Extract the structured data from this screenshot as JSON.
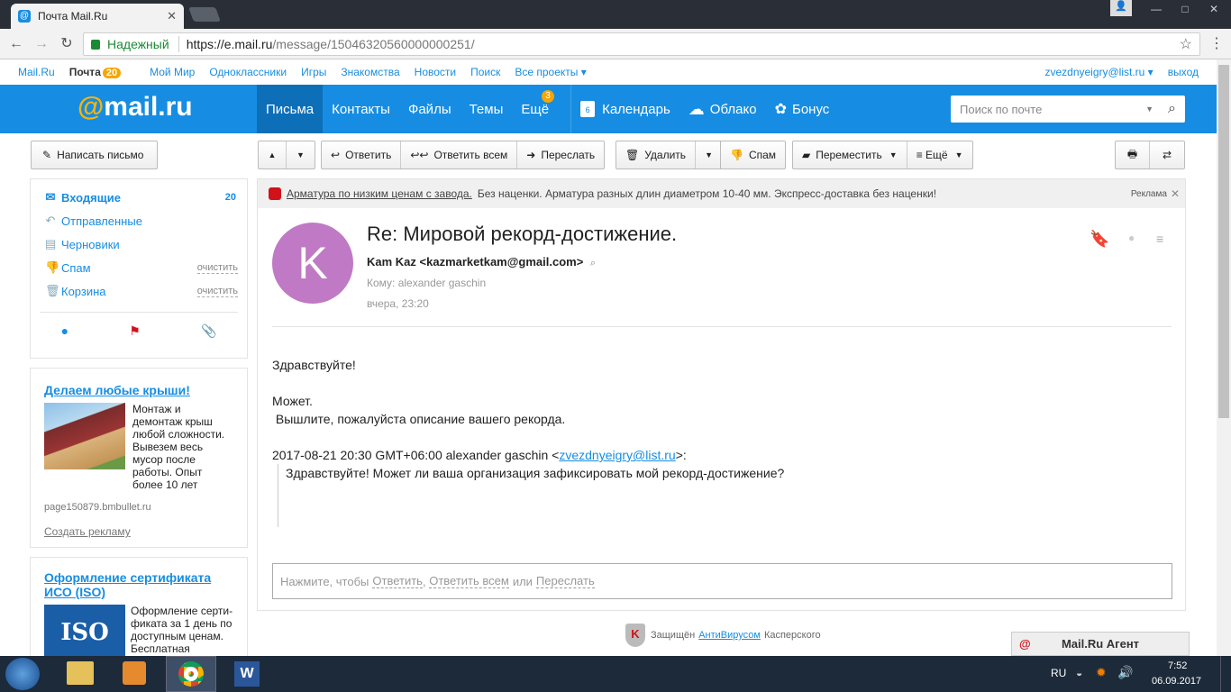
{
  "browser": {
    "tab_title": "Почта Mail.Ru",
    "secure_label": "Надежный",
    "url_host": "https://e.mail.ru",
    "url_path": "/message/15046320560000000251/"
  },
  "portal": {
    "links": [
      "Mail.Ru",
      "Почта",
      "Мой Мир",
      "Одноклассники",
      "Игры",
      "Знакомства",
      "Новости",
      "Поиск",
      "Все проекты ▾"
    ],
    "mail_badge": "20",
    "user": "zvezdnyeigry@list.ru ▾",
    "logout": "выход"
  },
  "header": {
    "logo_at": "@",
    "logo_text": "mail.ru",
    "nav": [
      "Письма",
      "Контакты",
      "Файлы",
      "Темы",
      "Ещё"
    ],
    "more_badge": "3",
    "calendar": "Календарь",
    "calendar_day": "6",
    "cloud": "Облако",
    "bonus": "Бонус",
    "search_placeholder": "Поиск по почте"
  },
  "sidebar": {
    "compose": "Написать письмо",
    "folders": [
      {
        "label": "Входящие",
        "count": "20"
      },
      {
        "label": "Отправленные"
      },
      {
        "label": "Черновики"
      },
      {
        "label": "Спам",
        "clear": "очистить"
      },
      {
        "label": "Корзина",
        "clear": "очистить"
      }
    ]
  },
  "ads": [
    {
      "title": "Делаем любые крыши!",
      "text": "Монтаж и демонтаж крыш любой сложности. Вывезем весь мусор после работы. Опыт более 10 лет",
      "domain": "page150879.bmbullet.ru",
      "create": "Создать рекламу"
    },
    {
      "title": "Оформление сертификата ИСО (ISO)",
      "text": "Оформление серти-фиката за 1 день по доступным ценам. Бесплатная",
      "logo": "ISO"
    }
  ],
  "toolbar": {
    "reply": "Ответить",
    "reply_all": "Ответить всем",
    "forward": "Переслать",
    "delete": "Удалить",
    "spam": "Спам",
    "move": "Переместить",
    "more": "≡ Ещё"
  },
  "promo": {
    "link": "Арматура по низким ценам с завода.",
    "text": "Без наценки. Арматура разных длин диаметром 10-40 мм. Экспресс-доставка без наценки!",
    "label": "Реклама"
  },
  "message": {
    "avatar_letter": "K",
    "subject": "Re: Мировой рекорд-достижение.",
    "from": "Kam Kaz <kazmarketkam@gmail.com>",
    "to": "Кому: alexander gaschin",
    "date": "вчера, 23:20",
    "body": {
      "greeting": "Здравствуйте!",
      "line1": "Может.",
      "line2": " Вышлите, пожалуйста описание вашего рекорда.",
      "quote_header_pre": "2017-08-21 20:30 GMT+06:00 alexander gaschin <",
      "quote_email": "zvezdnyeigry@list.ru",
      "quote_header_post": ">:",
      "quote": "Здравствуйте! Может ли ваша организация зафиксировать мой рекорд-достижение?"
    },
    "reply_prompt": "Нажмите, чтобы",
    "reply_link": "Ответить",
    "reply_all_link": "Ответить всем",
    "or": "или",
    "forward_link": "Переслать"
  },
  "footer": {
    "protected": "Защищён",
    "antivirus": "АнтиВирусом",
    "kaspersky": "Касперского"
  },
  "agent": "Mail.Ru Агент",
  "taskbar": {
    "lang": "RU",
    "time": "7:52",
    "date": "06.09.2017"
  }
}
